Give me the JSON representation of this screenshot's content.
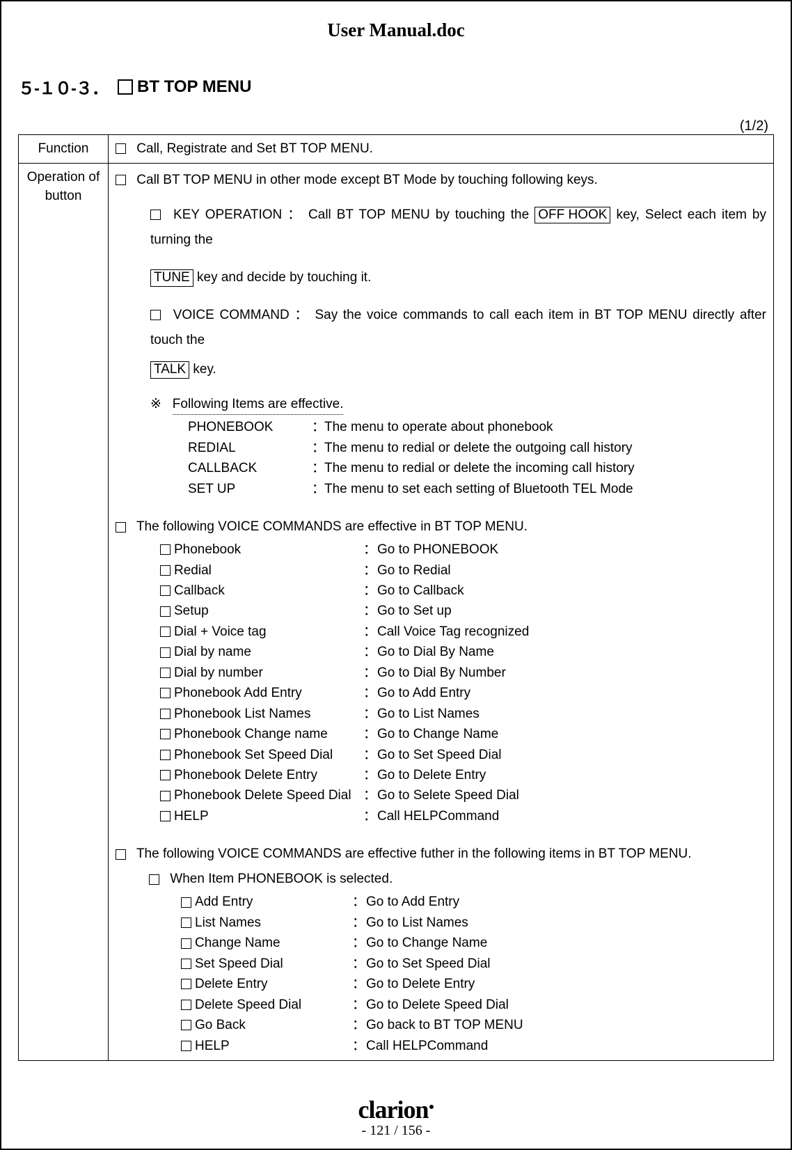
{
  "doc_title": "User Manual.doc",
  "section": {
    "number": "５-１０-３．",
    "title": "BT TOP MENU"
  },
  "page_count": "(1/2)",
  "function_label": "Function",
  "function_text": "Call, Registrate and Set BT TOP MENU.",
  "operation_label": "Operation of button",
  "op": {
    "intro": "Call BT TOP MENU in other mode except BT Mode by touching following keys.",
    "key_op_a": "KEY OPERATION ： Call BT TOP MENU by touching the ",
    "key_offhook": "OFF HOOK",
    "key_op_b": " key, Select each item by turning the",
    "tune_key": "TUNE",
    "tune_after": " key and decide by touching it.",
    "voice_a": "VOICE COMMAND ： Say the voice commands to call each item in BT TOP MENU directly after touch the",
    "talk_key": "TALK",
    "talk_after": " key.",
    "note_symbol": "※",
    "note_text": "Following Items are effective.",
    "items": [
      {
        "name": "PHONEBOOK",
        "desc": "The menu to operate about phonebook"
      },
      {
        "name": "REDIAL",
        "desc": "The menu to redial or delete the outgoing call history"
      },
      {
        "name": "CALLBACK",
        "desc": "The menu to redial or delete the incoming call history"
      },
      {
        "name": "SET UP",
        "desc": "The menu to set each setting of Bluetooth TEL Mode"
      }
    ],
    "vc_intro": "The following VOICE COMMANDS are effective in BT TOP MENU.",
    "vc": [
      {
        "cmd": "Phonebook",
        "desc": "Go to PHONEBOOK"
      },
      {
        "cmd": "Redial",
        "desc": "Go to Redial"
      },
      {
        "cmd": "Callback",
        "desc": "Go to Callback"
      },
      {
        "cmd": "Setup",
        "desc": "Go to Set up"
      },
      {
        "cmd": "Dial + Voice tag",
        "desc": "Call Voice Tag recognized"
      },
      {
        "cmd": "Dial by name",
        "desc": "Go to Dial By Name"
      },
      {
        "cmd": "Dial by number",
        "desc": "Go to Dial By Number"
      },
      {
        "cmd": "Phonebook Add Entry",
        "desc": "Go to Add Entry"
      },
      {
        "cmd": "Phonebook List Names",
        "desc": "Go to List Names"
      },
      {
        "cmd": "Phonebook Change name",
        "desc": "Go to Change Name"
      },
      {
        "cmd": "Phonebook Set Speed Dial",
        "desc": "Go to Set Speed Dial"
      },
      {
        "cmd": "Phonebook Delete Entry",
        "desc": "Go to Delete Entry"
      },
      {
        "cmd": "Phonebook Delete Speed Dial",
        "desc": "Go to Selete Speed Dial"
      },
      {
        "cmd": "HELP",
        "desc": "Call HELPCommand"
      }
    ],
    "further_intro": "The following VOICE COMMANDS are effective futher in the following items in BT TOP MENU.",
    "pb_selected": "When Item PHONEBOOK is selected.",
    "pb": [
      {
        "cmd": "Add Entry",
        "desc": "Go to Add Entry"
      },
      {
        "cmd": "List Names",
        "desc": "Go to List Names"
      },
      {
        "cmd": "Change Name",
        "desc": "Go to Change Name"
      },
      {
        "cmd": "Set Speed Dial",
        "desc": "Go to Set Speed Dial"
      },
      {
        "cmd": "Delete Entry",
        "desc": "Go to Delete Entry"
      },
      {
        "cmd": "Delete Speed Dial",
        "desc": "Go to Delete Speed Dial"
      },
      {
        "cmd": "Go Back",
        "desc": "Go back to BT TOP MENU"
      },
      {
        "cmd": "HELP",
        "desc": "Call HELPCommand"
      }
    ]
  },
  "footer": {
    "logo": "clarion",
    "page": "- 121 / 156 -"
  }
}
